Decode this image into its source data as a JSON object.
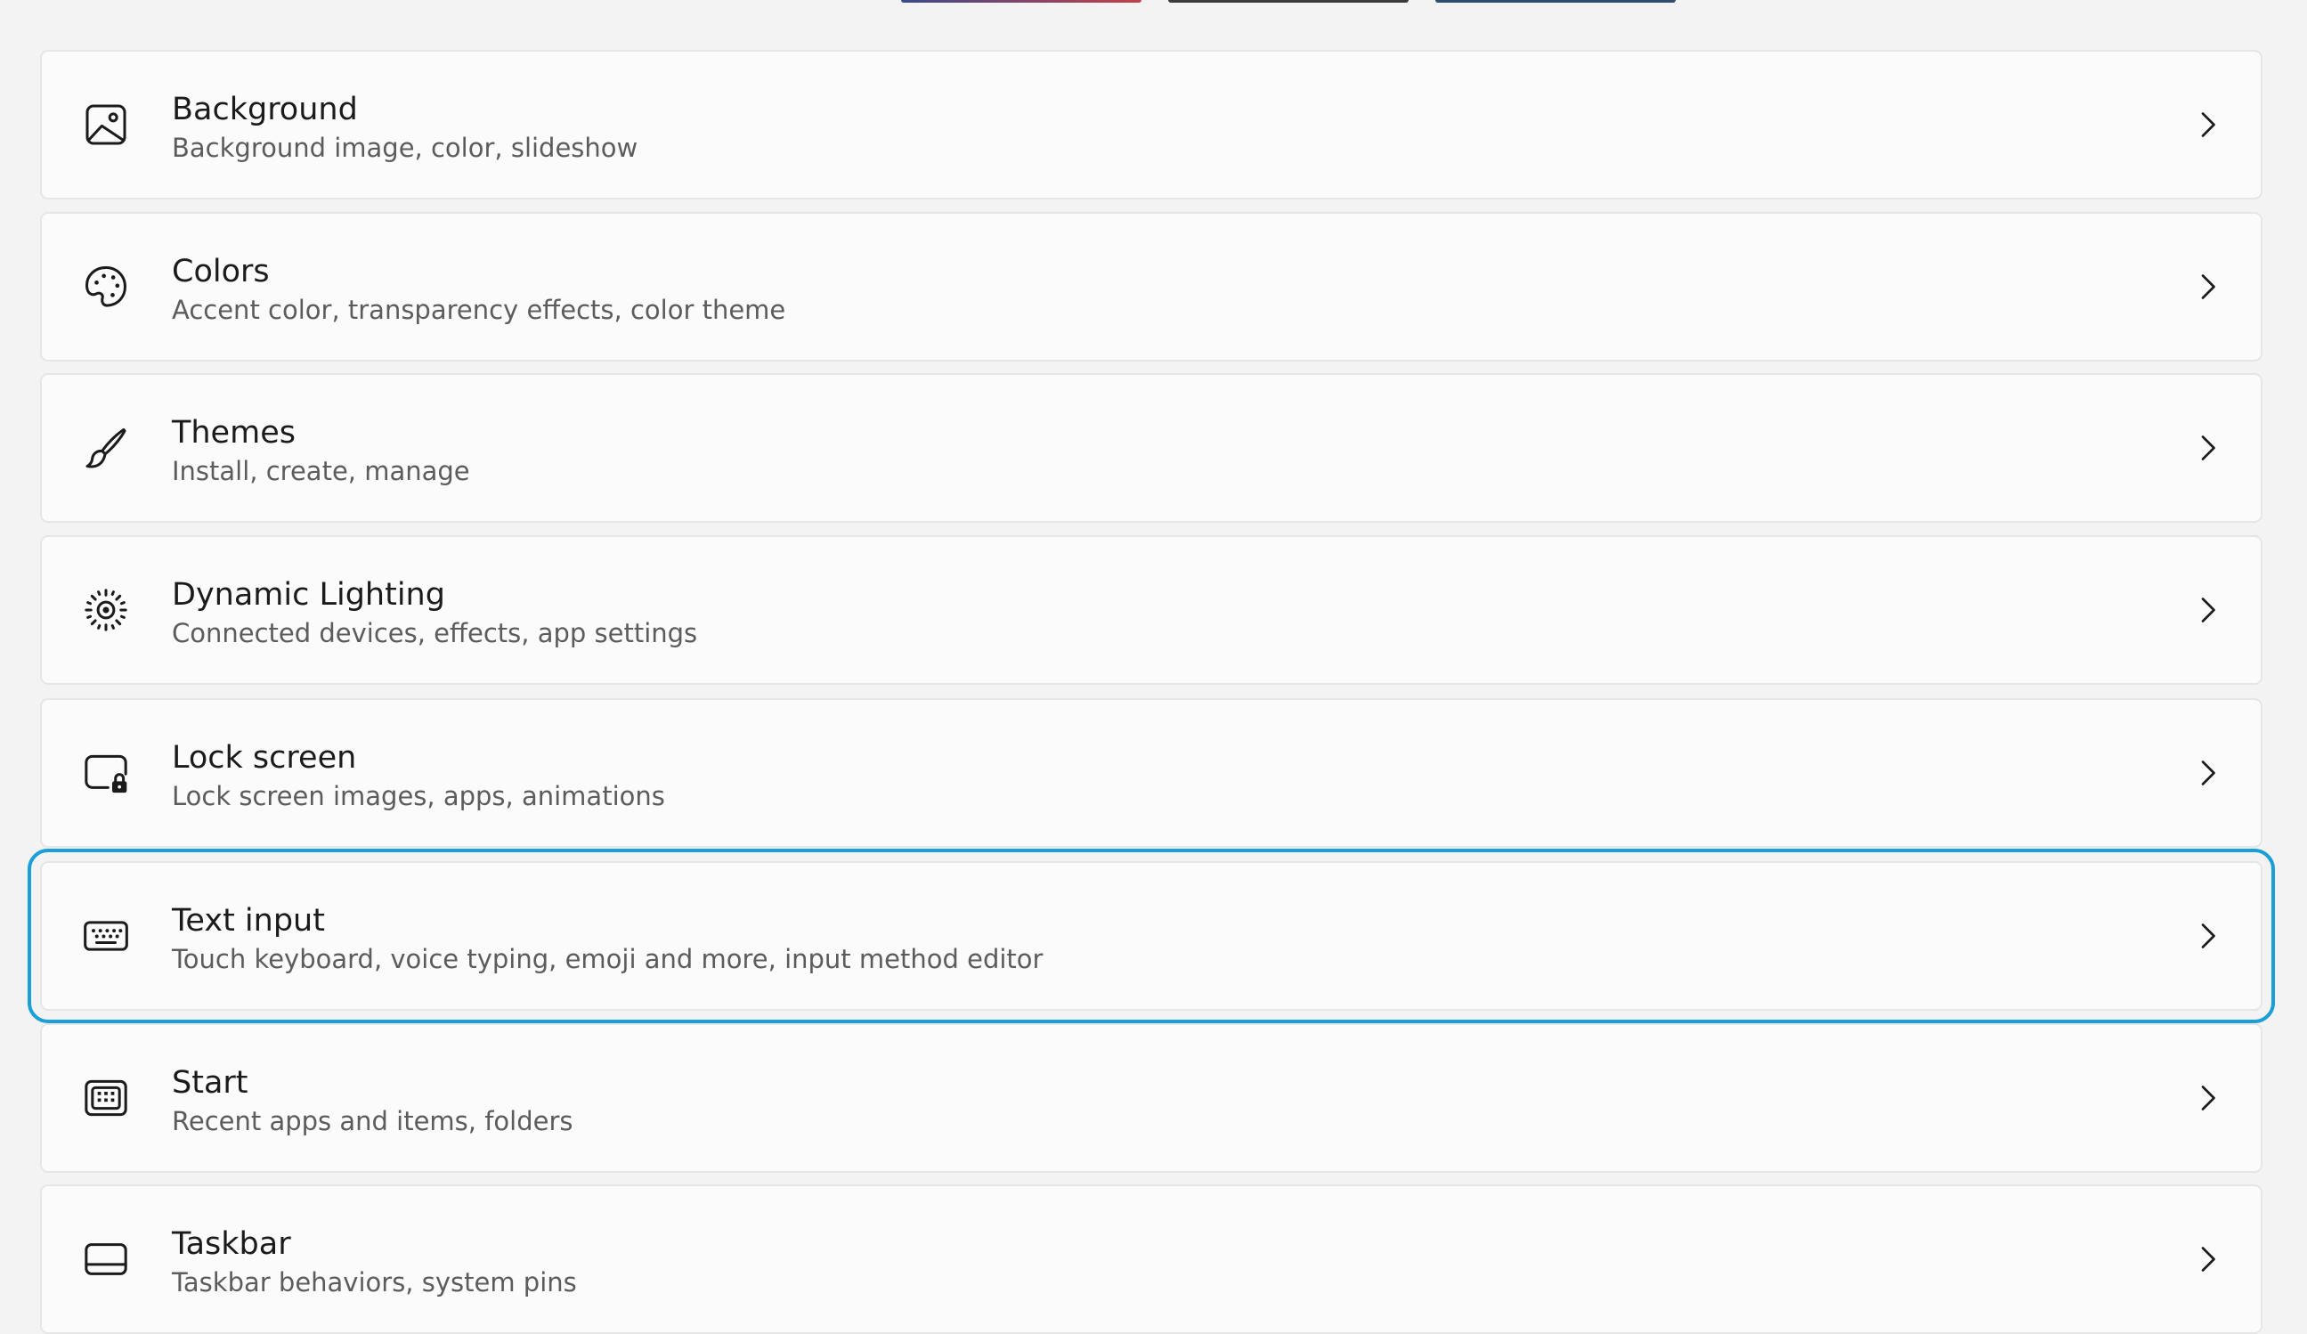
{
  "accent_color": "#1a9fd9",
  "items": [
    {
      "title": "Background",
      "subtitle": "Background image, color, slideshow",
      "icon": "image-icon"
    },
    {
      "title": "Colors",
      "subtitle": "Accent color, transparency effects, color theme",
      "icon": "palette-icon"
    },
    {
      "title": "Themes",
      "subtitle": "Install, create, manage",
      "icon": "brush-icon"
    },
    {
      "title": "Dynamic Lighting",
      "subtitle": "Connected devices, effects, app settings",
      "icon": "lighting-icon"
    },
    {
      "title": "Lock screen",
      "subtitle": "Lock screen images, apps, animations",
      "icon": "lock-screen-icon"
    },
    {
      "title": "Text input",
      "subtitle": "Touch keyboard, voice typing, emoji and more, input method editor",
      "icon": "keyboard-icon"
    },
    {
      "title": "Start",
      "subtitle": "Recent apps and items, folders",
      "icon": "start-icon"
    },
    {
      "title": "Taskbar",
      "subtitle": "Taskbar behaviors, system pins",
      "icon": "taskbar-icon"
    }
  ]
}
